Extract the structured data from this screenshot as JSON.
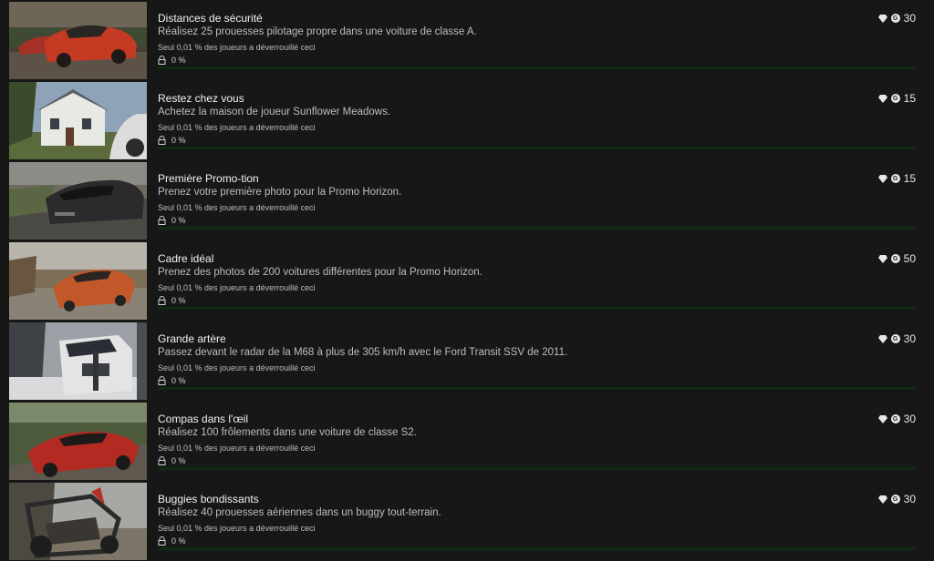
{
  "achievements": [
    {
      "title": "Distances de sécurité",
      "description": "Réalisez 25 prouesses pilotage propre dans une voiture de classe A.",
      "rarity": "Seul 0,01 % des joueurs a déverrouillé ceci",
      "progress_text": "0 %",
      "progress": 0,
      "gamerscore": "30",
      "thumbnail": "red-muscle-car"
    },
    {
      "title": "Restez chez vous",
      "description": "Achetez la maison de joueur Sunflower Meadows.",
      "rarity": "Seul 0,01 % des joueurs a déverrouillé ceci",
      "progress_text": "0 %",
      "progress": 0,
      "gamerscore": "15",
      "thumbnail": "white-house"
    },
    {
      "title": "Première Promo-tion",
      "description": "Prenez votre première photo pour la Promo Horizon.",
      "rarity": "Seul 0,01 % des joueurs a déverrouillé ceci",
      "progress_text": "0 %",
      "progress": 0,
      "gamerscore": "15",
      "thumbnail": "dark-car-road"
    },
    {
      "title": "Cadre idéal",
      "description": "Prenez des photos de 200 voitures différentes pour la Promo Horizon.",
      "rarity": "Seul 0,01 % des joueurs a déverrouillé ceci",
      "progress_text": "0 %",
      "progress": 0,
      "gamerscore": "50",
      "thumbnail": "orange-supercar"
    },
    {
      "title": "Grande artère",
      "description": "Passez devant le radar de la M68 à plus de 305 km/h avec le Ford Transit SSV de 2011.",
      "rarity": "Seul 0,01 % des joueurs a déverrouillé ceci",
      "progress_text": "0 %",
      "progress": 0,
      "gamerscore": "30",
      "thumbnail": "white-van-snow"
    },
    {
      "title": "Compas dans l'œil",
      "description": "Réalisez 100 frôlements dans une voiture de classe S2.",
      "rarity": "Seul 0,01 % des joueurs a déverrouillé ceci",
      "progress_text": "0 %",
      "progress": 0,
      "gamerscore": "30",
      "thumbnail": "red-lamborghini"
    },
    {
      "title": "Buggies bondissants",
      "description": "Réalisez 40 prouesses aériennes dans un buggy tout-terrain.",
      "rarity": "Seul 0,01 % des joueurs a déverrouillé ceci",
      "progress_text": "0 %",
      "progress": 0,
      "gamerscore": "30",
      "thumbnail": "offroad-buggy"
    }
  ],
  "colors": {
    "background": "#171717",
    "progress_track": "#0f2a14",
    "progress_fill": "#1db33a",
    "title_text": "#f2f2f2",
    "secondary_text": "#bdbdbd"
  },
  "icons": {
    "lock": "lock-icon",
    "diamond": "diamond-icon",
    "gamerscore": "gamerscore-icon",
    "gamerscore_letter": "G"
  }
}
